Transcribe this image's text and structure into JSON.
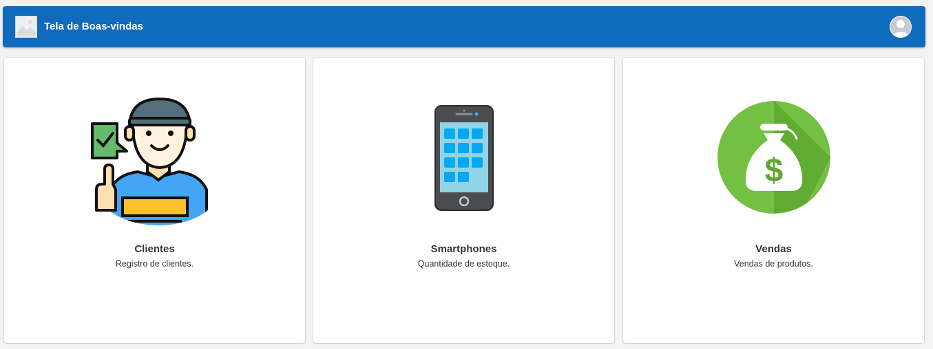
{
  "header": {
    "title": "Tela de Boas-vindas",
    "brand_color": "#0f6bbd",
    "logo_icon": "image-placeholder-icon",
    "profile_icon": "user-avatar-icon"
  },
  "tiles": [
    {
      "title": "Clientes",
      "subtitle": "Registro de clientes.",
      "icon": "customer-thumbs-up-icon"
    },
    {
      "title": "Smartphones",
      "subtitle": "Quantidade de estoque.",
      "icon": "smartphone-icon"
    },
    {
      "title": "Vendas",
      "subtitle": "Vendas de produtos.",
      "icon": "money-bag-icon"
    }
  ]
}
